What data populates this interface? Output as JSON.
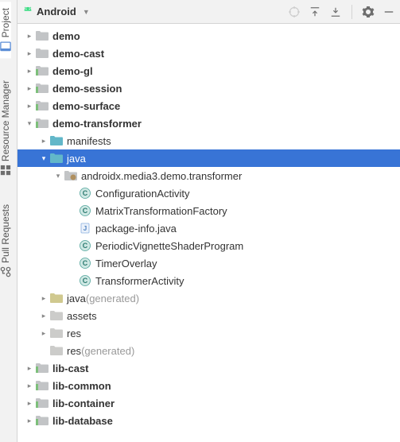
{
  "sidebar_tabs": {
    "project": "Project",
    "resource_manager": "Resource Manager",
    "pull_requests": "Pull Requests"
  },
  "panel": {
    "title": "Android"
  },
  "tree": [
    {
      "level": 0,
      "arrow": "right",
      "icon": "folder-closed",
      "label": "demo",
      "bold": true
    },
    {
      "level": 0,
      "arrow": "right",
      "icon": "folder-closed",
      "label": "demo-cast",
      "bold": true
    },
    {
      "level": 0,
      "arrow": "right",
      "icon": "module-folder",
      "label": "demo-gl",
      "bold": true
    },
    {
      "level": 0,
      "arrow": "right",
      "icon": "module-folder",
      "label": "demo-session",
      "bold": true
    },
    {
      "level": 0,
      "arrow": "right",
      "icon": "module-folder",
      "label": "demo-surface",
      "bold": true
    },
    {
      "level": 0,
      "arrow": "down",
      "icon": "module-folder",
      "label": "demo-transformer",
      "bold": true
    },
    {
      "level": 1,
      "arrow": "right",
      "icon": "folder-teal",
      "label": "manifests"
    },
    {
      "level": 1,
      "arrow": "down",
      "icon": "folder-teal",
      "label": "java",
      "selected": true
    },
    {
      "level": 2,
      "arrow": "down",
      "icon": "package",
      "label": "androidx.media3.demo.transformer"
    },
    {
      "level": 3,
      "arrow": "",
      "icon": "class",
      "label": "ConfigurationActivity"
    },
    {
      "level": 3,
      "arrow": "",
      "icon": "class",
      "label": "MatrixTransformationFactory"
    },
    {
      "level": 3,
      "arrow": "",
      "icon": "java-file",
      "label": "package-info.java"
    },
    {
      "level": 3,
      "arrow": "",
      "icon": "class",
      "label": "PeriodicVignetteShaderProgram"
    },
    {
      "level": 3,
      "arrow": "",
      "icon": "class",
      "label": "TimerOverlay"
    },
    {
      "level": 3,
      "arrow": "",
      "icon": "class",
      "label": "TransformerActivity"
    },
    {
      "level": 1,
      "arrow": "right",
      "icon": "folder-gen",
      "label": "java",
      "suffix": " (generated)",
      "muted": true
    },
    {
      "level": 1,
      "arrow": "right",
      "icon": "folder-gray",
      "label": "assets"
    },
    {
      "level": 1,
      "arrow": "right",
      "icon": "folder-gray",
      "label": "res"
    },
    {
      "level": 1,
      "arrow": "",
      "icon": "folder-gray",
      "label": "res",
      "suffix": " (generated)",
      "muted": true
    },
    {
      "level": 0,
      "arrow": "right",
      "icon": "module-folder",
      "label": "lib-cast",
      "bold": true
    },
    {
      "level": 0,
      "arrow": "right",
      "icon": "module-folder",
      "label": "lib-common",
      "bold": true
    },
    {
      "level": 0,
      "arrow": "right",
      "icon": "module-folder",
      "label": "lib-container",
      "bold": true
    },
    {
      "level": 0,
      "arrow": "right",
      "icon": "module-folder",
      "label": "lib-database",
      "bold": true
    }
  ]
}
